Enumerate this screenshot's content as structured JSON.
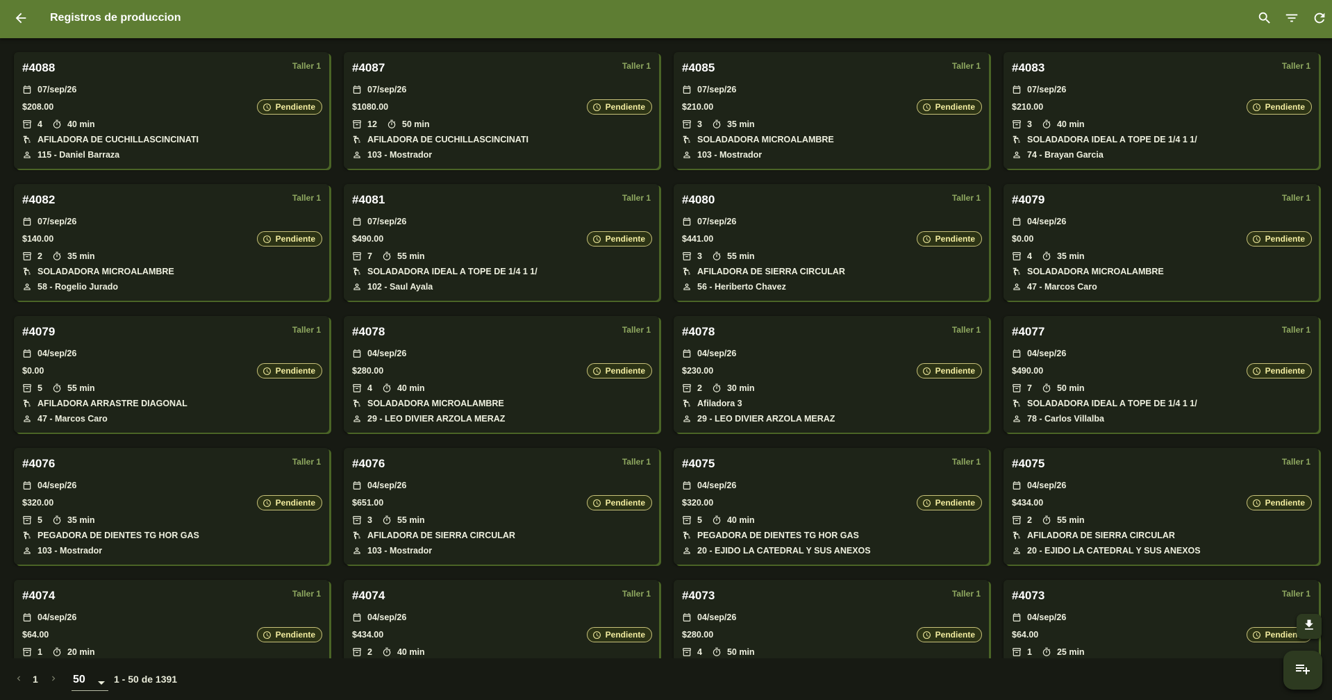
{
  "appbar": {
    "title": "Registros de produccion",
    "icons": [
      "arrow-back-icon",
      "search-icon",
      "filter-icon",
      "refresh-icon"
    ]
  },
  "status_color": "#f3eda0",
  "accent_color": "#5e7d33",
  "cards": [
    {
      "id": "#4088",
      "taller": "Taller 1",
      "date": "07/sep/26",
      "price": "$208.00",
      "status": "Pendiente",
      "qty": "4",
      "time": "40 min",
      "machine": "AFILADORA DE CUCHILLASCINCINATI",
      "user": "115 - Daniel Barraza"
    },
    {
      "id": "#4087",
      "taller": "Taller 1",
      "date": "07/sep/26",
      "price": "$1080.00",
      "status": "Pendiente",
      "qty": "12",
      "time": "50 min",
      "machine": "AFILADORA DE CUCHILLASCINCINATI",
      "user": "103 - Mostrador"
    },
    {
      "id": "#4085",
      "taller": "Taller 1",
      "date": "07/sep/26",
      "price": "$210.00",
      "status": "Pendiente",
      "qty": "3",
      "time": "35 min",
      "machine": "SOLADADORA MICROALAMBRE",
      "user": "103 - Mostrador"
    },
    {
      "id": "#4083",
      "taller": "Taller 1",
      "date": "07/sep/26",
      "price": "$210.00",
      "status": "Pendiente",
      "qty": "3",
      "time": "40 min",
      "machine": "SOLADADORA IDEAL A TOPE DE 1/4 1 1/",
      "user": "74 - Brayan Garcia"
    },
    {
      "id": "#4082",
      "taller": "Taller 1",
      "date": "07/sep/26",
      "price": "$140.00",
      "status": "Pendiente",
      "qty": "2",
      "time": "35 min",
      "machine": "SOLADADORA MICROALAMBRE",
      "user": "58 - Rogelio Jurado"
    },
    {
      "id": "#4081",
      "taller": "Taller 1",
      "date": "07/sep/26",
      "price": "$490.00",
      "status": "Pendiente",
      "qty": "7",
      "time": "55 min",
      "machine": "SOLADADORA IDEAL A TOPE DE 1/4 1 1/",
      "user": "102 - Saul Ayala"
    },
    {
      "id": "#4080",
      "taller": "Taller 1",
      "date": "07/sep/26",
      "price": "$441.00",
      "status": "Pendiente",
      "qty": "3",
      "time": "55 min",
      "machine": "AFILADORA  DE SIERRA CIRCULAR",
      "user": "56 - Heriberto Chavez"
    },
    {
      "id": "#4079",
      "taller": "Taller 1",
      "date": "04/sep/26",
      "price": "$0.00",
      "status": "Pendiente",
      "qty": "4",
      "time": "35 min",
      "machine": "SOLADADORA MICROALAMBRE",
      "user": "47 - Marcos Caro"
    },
    {
      "id": "#4079",
      "taller": "Taller 1",
      "date": "04/sep/26",
      "price": "$0.00",
      "status": "Pendiente",
      "qty": "5",
      "time": "55 min",
      "machine": "AFILADORA ARRASTRE DIAGONAL",
      "user": "47 - Marcos Caro"
    },
    {
      "id": "#4078",
      "taller": "Taller 1",
      "date": "04/sep/26",
      "price": "$280.00",
      "status": "Pendiente",
      "qty": "4",
      "time": "40 min",
      "machine": "SOLADADORA MICROALAMBRE",
      "user": "29 - LEO DIVIER ARZOLA MERAZ"
    },
    {
      "id": "#4078",
      "taller": "Taller 1",
      "date": "04/sep/26",
      "price": "$230.00",
      "status": "Pendiente",
      "qty": "2",
      "time": "30 min",
      "machine": "Afiladora 3",
      "user": "29 - LEO DIVIER ARZOLA MERAZ"
    },
    {
      "id": "#4077",
      "taller": "Taller 1",
      "date": "04/sep/26",
      "price": "$490.00",
      "status": "Pendiente",
      "qty": "7",
      "time": "50 min",
      "machine": "SOLADADORA IDEAL A TOPE DE 1/4 1 1/",
      "user": "78 - Carlos Villalba"
    },
    {
      "id": "#4076",
      "taller": "Taller 1",
      "date": "04/sep/26",
      "price": "$320.00",
      "status": "Pendiente",
      "qty": "5",
      "time": "35 min",
      "machine": "PEGADORA DE DIENTES TG HOR GAS",
      "user": "103 - Mostrador"
    },
    {
      "id": "#4076",
      "taller": "Taller 1",
      "date": "04/sep/26",
      "price": "$651.00",
      "status": "Pendiente",
      "qty": "3",
      "time": "55 min",
      "machine": "AFILADORA  DE SIERRA CIRCULAR",
      "user": "103 - Mostrador"
    },
    {
      "id": "#4075",
      "taller": "Taller 1",
      "date": "04/sep/26",
      "price": "$320.00",
      "status": "Pendiente",
      "qty": "5",
      "time": "40 min",
      "machine": "PEGADORA DE DIENTES TG HOR GAS",
      "user": "20 - EJIDO LA CATEDRAL Y SUS ANEXOS"
    },
    {
      "id": "#4075",
      "taller": "Taller 1",
      "date": "04/sep/26",
      "price": "$434.00",
      "status": "Pendiente",
      "qty": "2",
      "time": "55 min",
      "machine": "AFILADORA  DE SIERRA CIRCULAR",
      "user": "20 - EJIDO LA CATEDRAL Y SUS ANEXOS"
    },
    {
      "id": "#4074",
      "taller": "Taller 1",
      "date": "04/sep/26",
      "price": "$64.00",
      "status": "Pendiente",
      "qty": "1",
      "time": "20 min",
      "machine": "",
      "user": ""
    },
    {
      "id": "#4074",
      "taller": "Taller 1",
      "date": "04/sep/26",
      "price": "$434.00",
      "status": "Pendiente",
      "qty": "2",
      "time": "40 min",
      "machine": "",
      "user": ""
    },
    {
      "id": "#4073",
      "taller": "Taller 1",
      "date": "04/sep/26",
      "price": "$280.00",
      "status": "Pendiente",
      "qty": "4",
      "time": "50 min",
      "machine": "",
      "user": ""
    },
    {
      "id": "#4073",
      "taller": "Taller 1",
      "date": "04/sep/26",
      "price": "$64.00",
      "status": "Pendiente",
      "qty": "1",
      "time": "25 min",
      "machine": "",
      "user": ""
    }
  ],
  "pagination": {
    "page": "1",
    "page_size": "50",
    "range": "1 - 50 de 1391"
  },
  "fab": {
    "download_icon": "download-icon",
    "add_icon": "playlist-add-icon"
  }
}
